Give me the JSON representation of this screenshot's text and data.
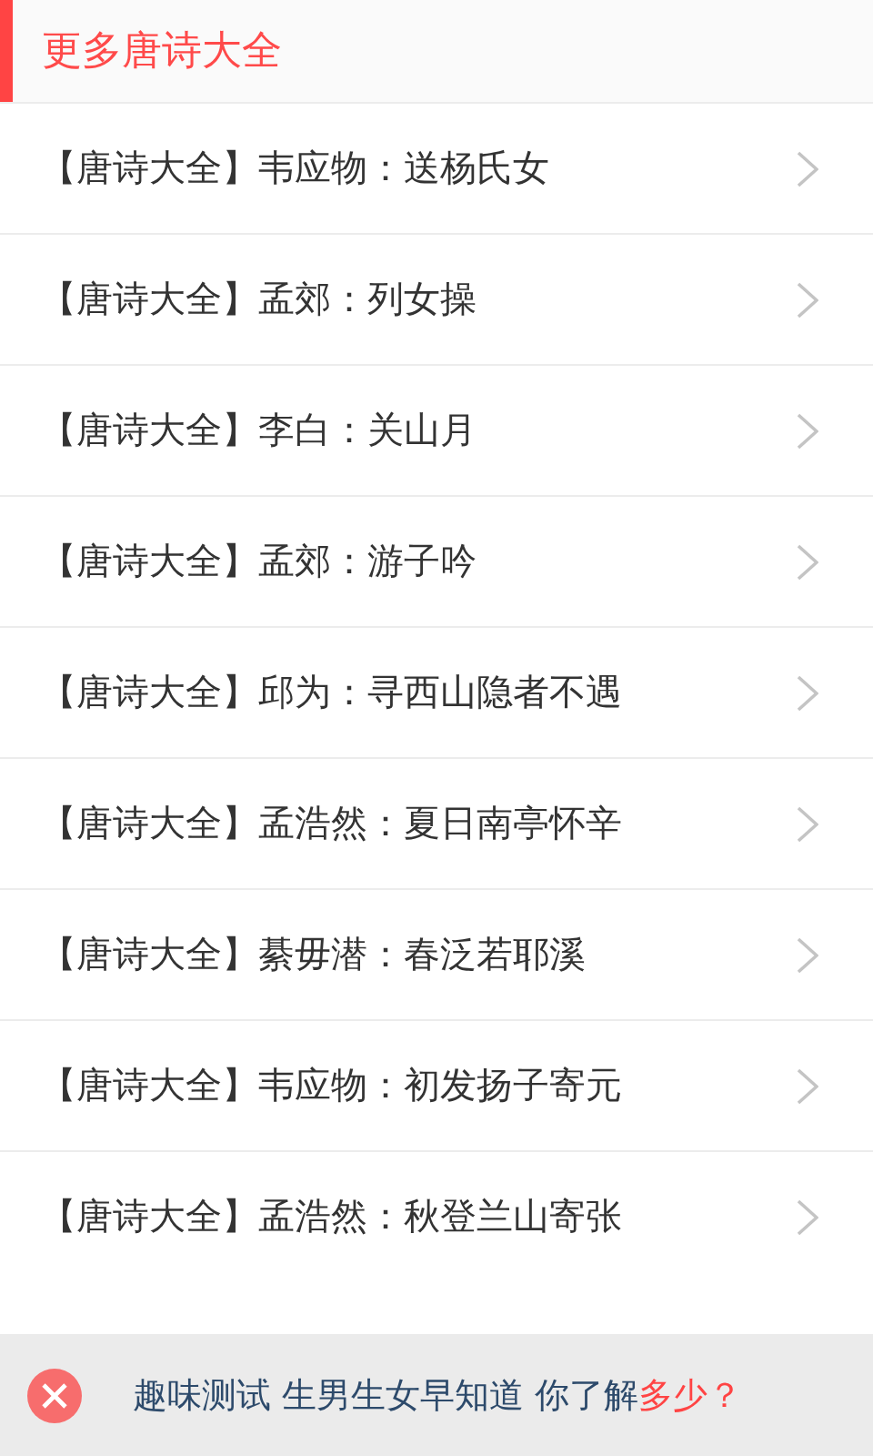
{
  "header": {
    "title": "更多唐诗大全"
  },
  "items": [
    {
      "label": "【唐诗大全】韦应物：送杨氏女"
    },
    {
      "label": "【唐诗大全】孟郊：列女操"
    },
    {
      "label": "【唐诗大全】李白：关山月"
    },
    {
      "label": "【唐诗大全】孟郊：游子吟"
    },
    {
      "label": "【唐诗大全】邱为：寻西山隐者不遇"
    },
    {
      "label": "【唐诗大全】孟浩然：夏日南亭怀辛"
    },
    {
      "label": "【唐诗大全】綦毋潜：春泛若耶溪"
    },
    {
      "label": "【唐诗大全】韦应物：初发扬子寄元"
    },
    {
      "label": "【唐诗大全】孟浩然：秋登兰山寄张"
    }
  ],
  "ad_banner": {
    "text": "趣味测试 生男生女早知道 你了解",
    "highlight": "多少？"
  }
}
